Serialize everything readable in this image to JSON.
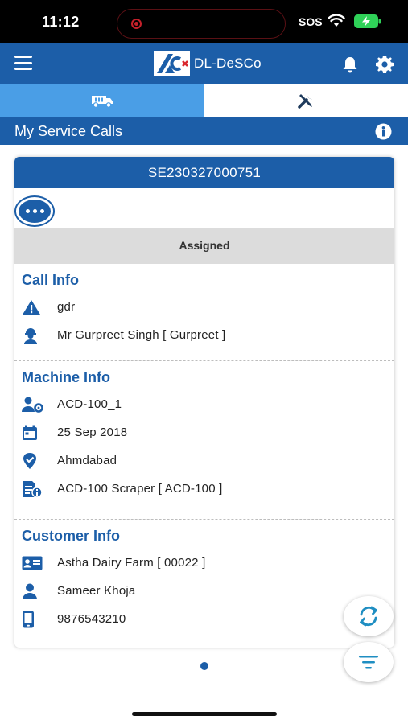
{
  "status_bar": {
    "time": "11:12",
    "sos": "SOS"
  },
  "header": {
    "app_name": "DL-DeSCo"
  },
  "tabs": [
    {
      "name": "machines",
      "icon": "truck-icon",
      "active": true
    },
    {
      "name": "service",
      "icon": "tools-icon",
      "active": false
    }
  ],
  "section": {
    "title": "My Service Calls"
  },
  "card": {
    "call_number": "SE230327000751",
    "status": "Assigned",
    "call_info": {
      "title": "Call Info",
      "rows": [
        {
          "icon": "warning-icon",
          "text": "gdr"
        },
        {
          "icon": "engineer-icon",
          "text": "Mr Gurpreet Singh [ Gurpreet ]"
        }
      ]
    },
    "machine_info": {
      "title": "Machine Info",
      "rows": [
        {
          "icon": "user-gear-icon",
          "text": "ACD-100_1"
        },
        {
          "icon": "calendar-icon",
          "text": "25 Sep 2018"
        },
        {
          "icon": "location-icon",
          "text": "Ahmdabad"
        },
        {
          "icon": "document-info-icon",
          "text": "ACD-100 Scraper [ ACD-100 ]"
        }
      ]
    },
    "customer_info": {
      "title": "Customer Info",
      "rows": [
        {
          "icon": "id-card-icon",
          "text": "Astha Dairy Farm [ 00022 ]"
        },
        {
          "icon": "person-icon",
          "text": "Sameer Khoja"
        },
        {
          "icon": "mobile-icon",
          "text": "9876543210"
        }
      ]
    }
  },
  "colors": {
    "primary": "#1c5ea8",
    "tab_active": "#4a9ee6",
    "status_bg": "#dcdcdc"
  }
}
